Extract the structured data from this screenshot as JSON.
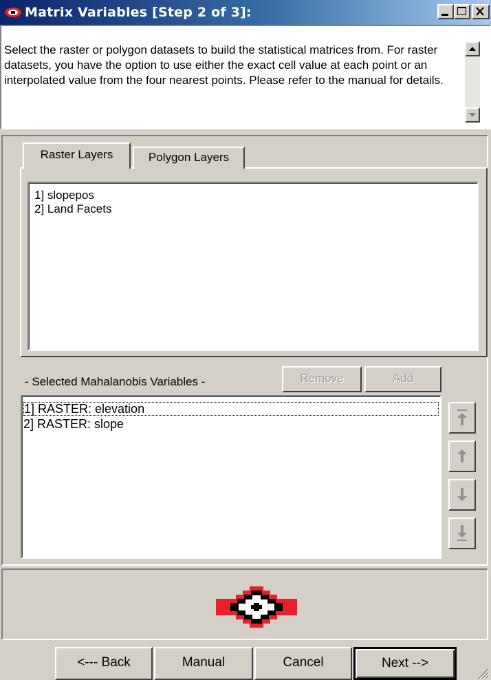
{
  "window": {
    "title": "Matrix Variables [Step 2 of 3]:",
    "minimize_label": "_",
    "maximize_label": "□",
    "close_label": "X"
  },
  "instructions": {
    "text": "Select the raster or polygon datasets to build the statistical matrices from. For raster datasets, you have the option to use either the exact cell value at each point or an interpolated value from the four nearest points.  Please refer to the manual for details."
  },
  "tabs": [
    {
      "label": "Raster Layers",
      "active": true
    },
    {
      "label": "Polygon Layers",
      "active": false
    }
  ],
  "raster_layers": [
    "1] slopepos",
    "2] Land Facets"
  ],
  "selected_section": {
    "label": "- Selected Mahalanobis Variables -",
    "remove_label": "Remove",
    "add_label": "Add",
    "items": [
      "1] RASTER: elevation",
      "2] RASTER: slope"
    ]
  },
  "order_buttons": [
    "move-top-icon",
    "move-up-icon",
    "move-down-icon",
    "move-bottom-icon"
  ],
  "footer": {
    "back_label": "<--- Back",
    "manual_label": "Manual",
    "cancel_label": "Cancel",
    "next_label": "Next -->"
  },
  "colors": {
    "titlebar_start": "#0a246a",
    "titlebar_end": "#a6caf0",
    "logo_red": "#e8202a",
    "logo_black": "#000000",
    "face": "#d4d0c8"
  }
}
